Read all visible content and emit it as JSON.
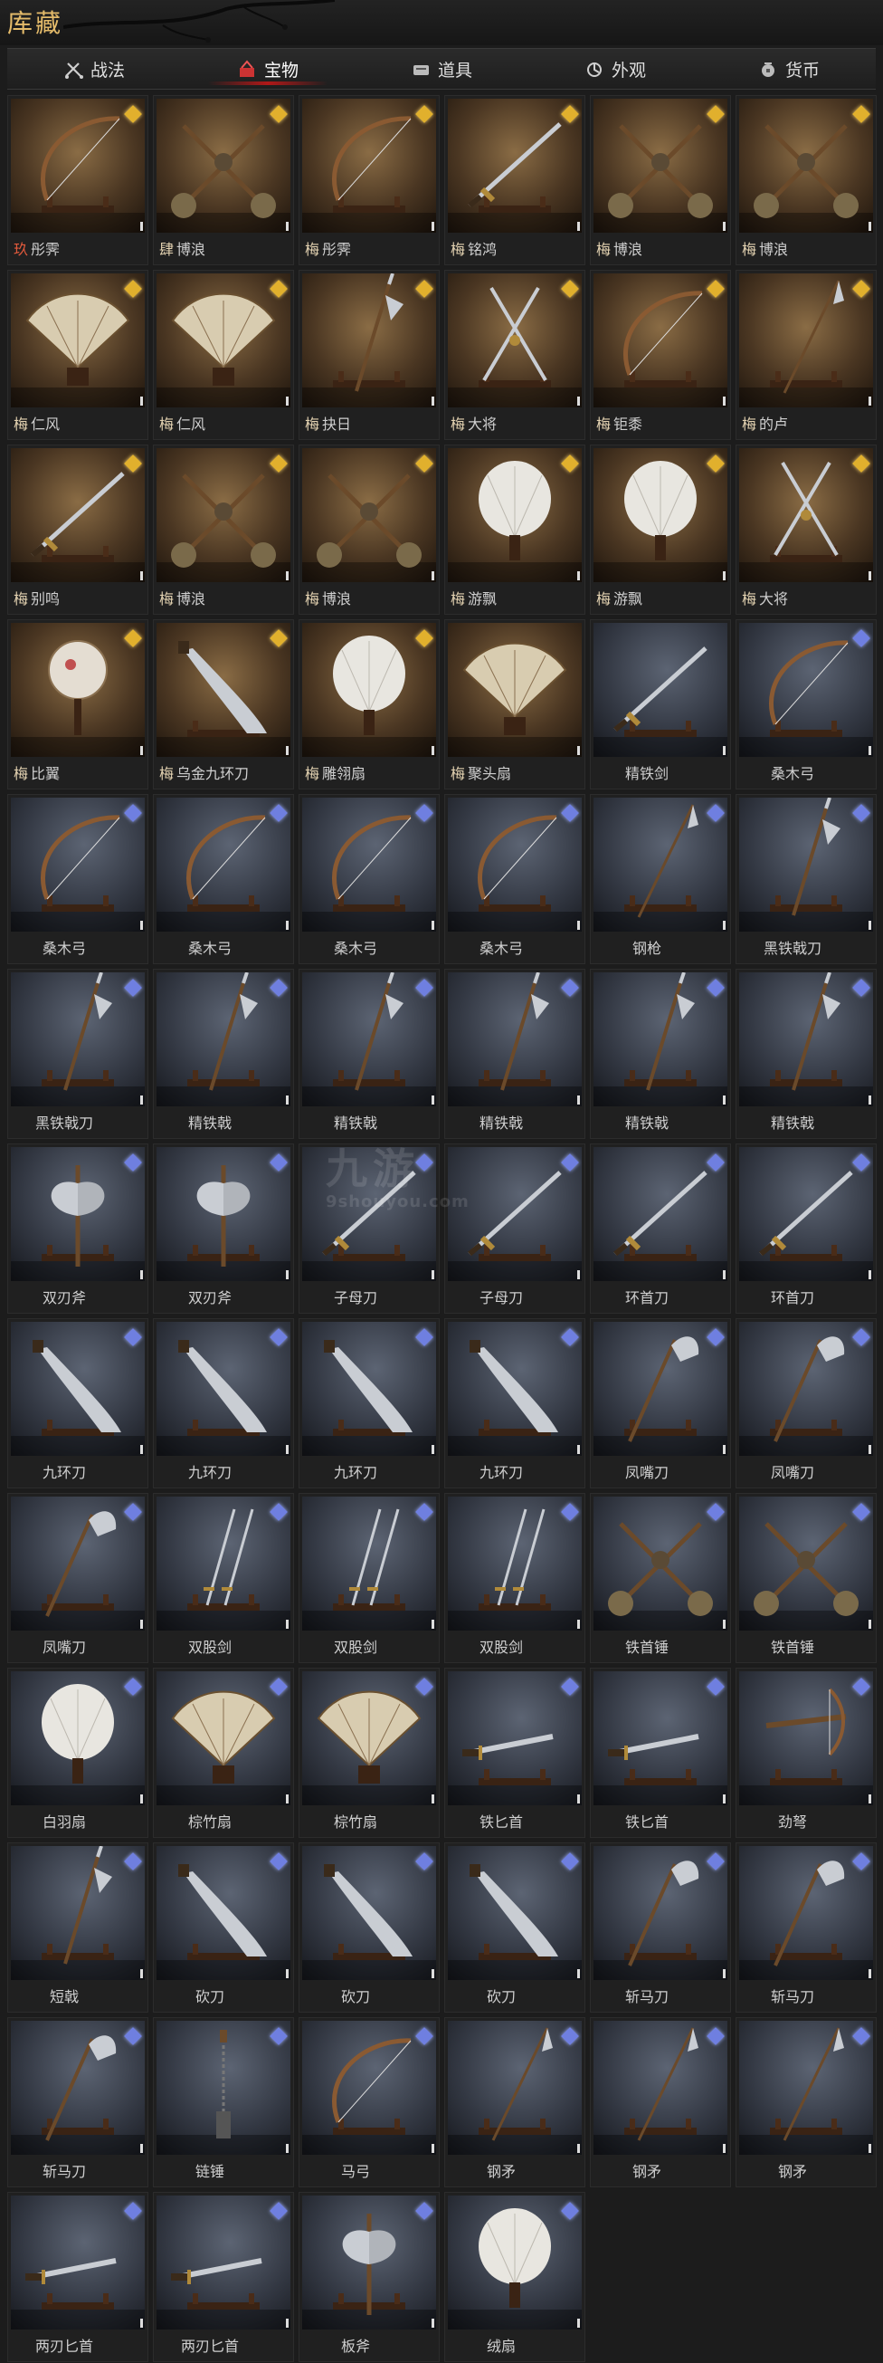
{
  "page": {
    "title": "库藏"
  },
  "tabs": [
    {
      "label": "战法",
      "icon": "swords-icon",
      "active": false
    },
    {
      "label": "宝物",
      "icon": "treasure-icon",
      "active": true
    },
    {
      "label": "道具",
      "icon": "item-icon",
      "active": false
    },
    {
      "label": "外观",
      "icon": "appearance-icon",
      "active": false
    },
    {
      "label": "货币",
      "icon": "currency-icon",
      "active": false
    }
  ],
  "colors": {
    "gold_frame": "#4a3622",
    "blue_frame": "#333843",
    "active_tab_underline": "#b01818",
    "title": "#e4bb6a"
  },
  "watermark": {
    "text": "九游",
    "url": "9shouyou.com"
  },
  "items": [
    {
      "badge": "玖",
      "badge_color": "red",
      "name": "彤霁",
      "frame": "gold",
      "art": "bow",
      "gem": true
    },
    {
      "badge": "肆",
      "name": "博浪",
      "frame": "gold",
      "art": "hammers",
      "gem": true
    },
    {
      "badge": "梅",
      "name": "彤霁",
      "frame": "gold",
      "art": "bow",
      "gem": true
    },
    {
      "badge": "梅",
      "name": "铭鸿",
      "frame": "gold",
      "art": "sword",
      "gem": true
    },
    {
      "badge": "梅",
      "name": "博浪",
      "frame": "gold",
      "art": "hammers",
      "gem": true
    },
    {
      "badge": "梅",
      "name": "博浪",
      "frame": "gold",
      "art": "hammers",
      "gem": true
    },
    {
      "badge": "梅",
      "name": "仁风",
      "frame": "gold",
      "art": "fan",
      "gem": true
    },
    {
      "badge": "梅",
      "name": "仁风",
      "frame": "gold",
      "art": "fan",
      "gem": true
    },
    {
      "badge": "梅",
      "name": "抉日",
      "frame": "gold",
      "art": "halberd",
      "gem": true
    },
    {
      "badge": "梅",
      "name": "大将",
      "frame": "gold",
      "art": "crossed",
      "gem": true
    },
    {
      "badge": "梅",
      "name": "钜黍",
      "frame": "gold",
      "art": "bow",
      "gem": true
    },
    {
      "badge": "梅",
      "name": "的卢",
      "frame": "gold",
      "art": "spear",
      "gem": true
    },
    {
      "badge": "梅",
      "name": "别鸣",
      "frame": "gold",
      "art": "sword",
      "gem": true
    },
    {
      "badge": "梅",
      "name": "博浪",
      "frame": "gold",
      "art": "hammers",
      "gem": true
    },
    {
      "badge": "梅",
      "name": "博浪",
      "frame": "gold",
      "art": "hammers",
      "gem": true
    },
    {
      "badge": "梅",
      "name": "游飘",
      "frame": "gold",
      "art": "featherfan",
      "gem": true
    },
    {
      "badge": "梅",
      "name": "游飘",
      "frame": "gold",
      "art": "featherfan",
      "gem": true
    },
    {
      "badge": "梅",
      "name": "大将",
      "frame": "gold",
      "art": "crossed",
      "gem": true
    },
    {
      "badge": "梅",
      "name": "比翼",
      "frame": "gold",
      "art": "roundfan",
      "gem": true
    },
    {
      "badge": "梅",
      "name": "乌金九环刀",
      "frame": "gold",
      "art": "broadblade",
      "gem": true
    },
    {
      "badge": "梅",
      "name": "雕翎扇",
      "frame": "gold",
      "art": "featherfan",
      "gem": true
    },
    {
      "badge": "梅",
      "name": "聚头扇",
      "frame": "gold",
      "art": "fan",
      "gem": false
    },
    {
      "badge": "",
      "name": "精铁剑",
      "frame": "blue",
      "art": "sword",
      "gem": false
    },
    {
      "badge": "",
      "name": "桑木弓",
      "frame": "blue",
      "art": "bow",
      "gem": true
    },
    {
      "badge": "",
      "name": "桑木弓",
      "frame": "blue",
      "art": "bow",
      "gem": true
    },
    {
      "badge": "",
      "name": "桑木弓",
      "frame": "blue",
      "art": "bow",
      "gem": true
    },
    {
      "badge": "",
      "name": "桑木弓",
      "frame": "blue",
      "art": "bow",
      "gem": true
    },
    {
      "badge": "",
      "name": "桑木弓",
      "frame": "blue",
      "art": "bow",
      "gem": true
    },
    {
      "badge": "",
      "name": "钢枪",
      "frame": "blue",
      "art": "spear",
      "gem": true
    },
    {
      "badge": "",
      "name": "黑铁戟刀",
      "frame": "blue",
      "art": "halberd",
      "gem": true
    },
    {
      "badge": "",
      "name": "黑铁戟刀",
      "frame": "blue",
      "art": "halberd",
      "gem": true
    },
    {
      "badge": "",
      "name": "精铁戟",
      "frame": "blue",
      "art": "halberd",
      "gem": true
    },
    {
      "badge": "",
      "name": "精铁戟",
      "frame": "blue",
      "art": "halberd",
      "gem": true
    },
    {
      "badge": "",
      "name": "精铁戟",
      "frame": "blue",
      "art": "halberd",
      "gem": true
    },
    {
      "badge": "",
      "name": "精铁戟",
      "frame": "blue",
      "art": "halberd",
      "gem": true
    },
    {
      "badge": "",
      "name": "精铁戟",
      "frame": "blue",
      "art": "halberd",
      "gem": true
    },
    {
      "badge": "",
      "name": "双刃斧",
      "frame": "blue",
      "art": "axe",
      "gem": true
    },
    {
      "badge": "",
      "name": "双刃斧",
      "frame": "blue",
      "art": "axe",
      "gem": true
    },
    {
      "badge": "",
      "name": "子母刀",
      "frame": "blue",
      "art": "sword",
      "gem": true
    },
    {
      "badge": "",
      "name": "子母刀",
      "frame": "blue",
      "art": "sword",
      "gem": true
    },
    {
      "badge": "",
      "name": "环首刀",
      "frame": "blue",
      "art": "sword",
      "gem": true
    },
    {
      "badge": "",
      "name": "环首刀",
      "frame": "blue",
      "art": "sword",
      "gem": true
    },
    {
      "badge": "",
      "name": "九环刀",
      "frame": "blue",
      "art": "broadblade",
      "gem": true
    },
    {
      "badge": "",
      "name": "九环刀",
      "frame": "blue",
      "art": "broadblade",
      "gem": true
    },
    {
      "badge": "",
      "name": "九环刀",
      "frame": "blue",
      "art": "broadblade",
      "gem": true
    },
    {
      "badge": "",
      "name": "九环刀",
      "frame": "blue",
      "art": "broadblade",
      "gem": true
    },
    {
      "badge": "",
      "name": "凤嘴刀",
      "frame": "blue",
      "art": "glaive",
      "gem": true
    },
    {
      "badge": "",
      "name": "凤嘴刀",
      "frame": "blue",
      "art": "glaive",
      "gem": true
    },
    {
      "badge": "",
      "name": "凤嘴刀",
      "frame": "blue",
      "art": "glaive",
      "gem": true
    },
    {
      "badge": "",
      "name": "双股剑",
      "frame": "blue",
      "art": "twinswords",
      "gem": true
    },
    {
      "badge": "",
      "name": "双股剑",
      "frame": "blue",
      "art": "twinswords",
      "gem": true
    },
    {
      "badge": "",
      "name": "双股剑",
      "frame": "blue",
      "art": "twinswords",
      "gem": true
    },
    {
      "badge": "",
      "name": "铁首锤",
      "frame": "blue",
      "art": "hammers",
      "gem": true
    },
    {
      "badge": "",
      "name": "铁首锤",
      "frame": "blue",
      "art": "hammers",
      "gem": true
    },
    {
      "badge": "",
      "name": "白羽扇",
      "frame": "blue",
      "art": "featherfan",
      "gem": true
    },
    {
      "badge": "",
      "name": "棕竹扇",
      "frame": "blue",
      "art": "fan",
      "gem": true
    },
    {
      "badge": "",
      "name": "棕竹扇",
      "frame": "blue",
      "art": "fan",
      "gem": true
    },
    {
      "badge": "",
      "name": "铁匕首",
      "frame": "blue",
      "art": "dagger",
      "gem": true
    },
    {
      "badge": "",
      "name": "铁匕首",
      "frame": "blue",
      "art": "dagger",
      "gem": true
    },
    {
      "badge": "",
      "name": "劲弩",
      "frame": "blue",
      "art": "crossbow",
      "gem": true
    },
    {
      "badge": "",
      "name": "短戟",
      "frame": "blue",
      "art": "halberd",
      "gem": true
    },
    {
      "badge": "",
      "name": "砍刀",
      "frame": "blue",
      "art": "broadblade",
      "gem": true
    },
    {
      "badge": "",
      "name": "砍刀",
      "frame": "blue",
      "art": "broadblade",
      "gem": true
    },
    {
      "badge": "",
      "name": "砍刀",
      "frame": "blue",
      "art": "broadblade",
      "gem": true
    },
    {
      "badge": "",
      "name": "斩马刀",
      "frame": "blue",
      "art": "glaive",
      "gem": true
    },
    {
      "badge": "",
      "name": "斩马刀",
      "frame": "blue",
      "art": "glaive",
      "gem": true
    },
    {
      "badge": "",
      "name": "斩马刀",
      "frame": "blue",
      "art": "glaive",
      "gem": true
    },
    {
      "badge": "",
      "name": "链锤",
      "frame": "blue",
      "art": "flail",
      "gem": true
    },
    {
      "badge": "",
      "name": "马弓",
      "frame": "blue",
      "art": "bow",
      "gem": true
    },
    {
      "badge": "",
      "name": "钢矛",
      "frame": "blue",
      "art": "spear",
      "gem": true
    },
    {
      "badge": "",
      "name": "钢矛",
      "frame": "blue",
      "art": "spear",
      "gem": true
    },
    {
      "badge": "",
      "name": "钢矛",
      "frame": "blue",
      "art": "spear",
      "gem": true
    },
    {
      "badge": "",
      "name": "两刃匕首",
      "frame": "blue",
      "art": "dagger",
      "gem": true
    },
    {
      "badge": "",
      "name": "两刃匕首",
      "frame": "blue",
      "art": "dagger",
      "gem": true
    },
    {
      "badge": "",
      "name": "板斧",
      "frame": "blue",
      "art": "axe",
      "gem": true
    },
    {
      "badge": "",
      "name": "绒扇",
      "frame": "blue",
      "art": "featherfan",
      "gem": true
    }
  ]
}
